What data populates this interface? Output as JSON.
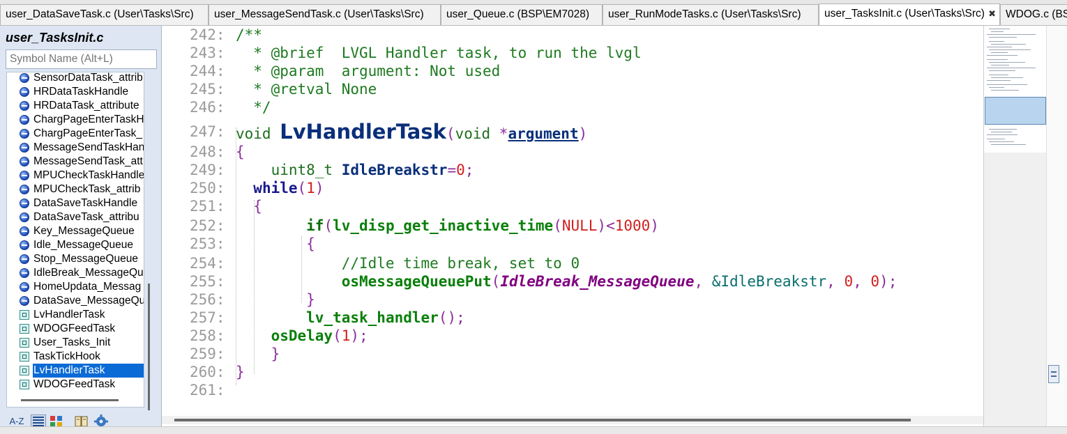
{
  "tabs": [
    {
      "label": "user_DataSaveTask.c (User\\Tasks\\Src)"
    },
    {
      "label": "user_MessageSendTask.c (User\\Tasks\\Src)"
    },
    {
      "label": "user_Queue.c (BSP\\EM7028)"
    },
    {
      "label": "user_RunModeTasks.c (User\\Tasks\\Src)"
    },
    {
      "label": "user_TasksInit.c (User\\Tasks\\Src)"
    },
    {
      "label": "WDOG.c (BS"
    }
  ],
  "active_tab_close": "✖",
  "panel": {
    "title": "user_TasksInit.c",
    "search_placeholder": "Symbol Name (Alt+L)"
  },
  "symbols": [
    {
      "label": "SensorDataTask_attrib",
      "icon": "variable-icon"
    },
    {
      "label": "HRDataTaskHandle",
      "icon": "variable-icon"
    },
    {
      "label": "HRDataTask_attribute",
      "icon": "variable-icon"
    },
    {
      "label": "ChargPageEnterTaskH",
      "icon": "variable-icon"
    },
    {
      "label": "ChargPageEnterTask_",
      "icon": "variable-icon"
    },
    {
      "label": "MessageSendTaskHan",
      "icon": "variable-icon"
    },
    {
      "label": "MessageSendTask_att",
      "icon": "variable-icon"
    },
    {
      "label": "MPUCheckTaskHandle",
      "icon": "variable-icon"
    },
    {
      "label": "MPUCheckTask_attrib",
      "icon": "variable-icon"
    },
    {
      "label": "DataSaveTaskHandle",
      "icon": "variable-icon"
    },
    {
      "label": "DataSaveTask_attribu",
      "icon": "variable-icon"
    },
    {
      "label": "Key_MessageQueue",
      "icon": "variable-icon"
    },
    {
      "label": "Idle_MessageQueue",
      "icon": "variable-icon"
    },
    {
      "label": "Stop_MessageQueue",
      "icon": "variable-icon"
    },
    {
      "label": "IdleBreak_MessageQu",
      "icon": "variable-icon"
    },
    {
      "label": "HomeUpdata_Messag",
      "icon": "variable-icon"
    },
    {
      "label": "DataSave_MessageQu",
      "icon": "variable-icon"
    },
    {
      "label": "LvHandlerTask",
      "icon": "function-prototype-icon"
    },
    {
      "label": "WDOGFeedTask",
      "icon": "function-prototype-icon"
    },
    {
      "label": "User_Tasks_Init",
      "icon": "function-icon"
    },
    {
      "label": "TaskTickHook",
      "icon": "function-icon"
    },
    {
      "label": "LvHandlerTask",
      "icon": "function-icon",
      "selected": true
    },
    {
      "label": "WDOGFeedTask",
      "icon": "function-icon"
    }
  ],
  "panel_toolbar": {
    "sort_label": "A-Z"
  },
  "editor": {
    "line_numbers": [
      "242:",
      "243:",
      "244:",
      "245:",
      "246:",
      "247:",
      "248:",
      "249:",
      "250:",
      "251:",
      "252:",
      "253:",
      "254:",
      "255:",
      "256:",
      "257:",
      "258:",
      "259:",
      "260:",
      "261:"
    ],
    "c242": "/**",
    "c243": "  * @brief  LVGL Handler task, to run the lvgl",
    "c244": "  * @param  argument: Not used",
    "c245": "  * @retval None",
    "c246": "  */",
    "t_void": "void ",
    "t_fname": "LvHandlerTask",
    "t_paren_open": "(",
    "t_void2": "void ",
    "t_star": "*",
    "t_argument": "argument",
    "t_paren_close": ")",
    "t_lbrace": "{",
    "t_rbrace": "}",
    "t_uint8": "uint8_t ",
    "t_idle": "IdleBreakstr",
    "t_eq": "=",
    "t_zero": "0",
    "t_semi": ";",
    "t_while": "while",
    "t_one": "1",
    "t_if": "if",
    "t_getinactive": "lv_disp_get_inactive_time",
    "t_null": "NULL",
    "t_lt": "<",
    "t_thousand": "1000",
    "c254": "//Idle time break, set to 0",
    "t_put": "osMessageQueuePut",
    "t_queue": "IdleBreak_MessageQueue",
    "t_comma": ", ",
    "t_ref": "&IdleBreakstr",
    "t_lvtask": "lv_task_handler",
    "t_call_end": "();",
    "t_osdelay": "osDelay",
    "t_close_semi": ");"
  }
}
